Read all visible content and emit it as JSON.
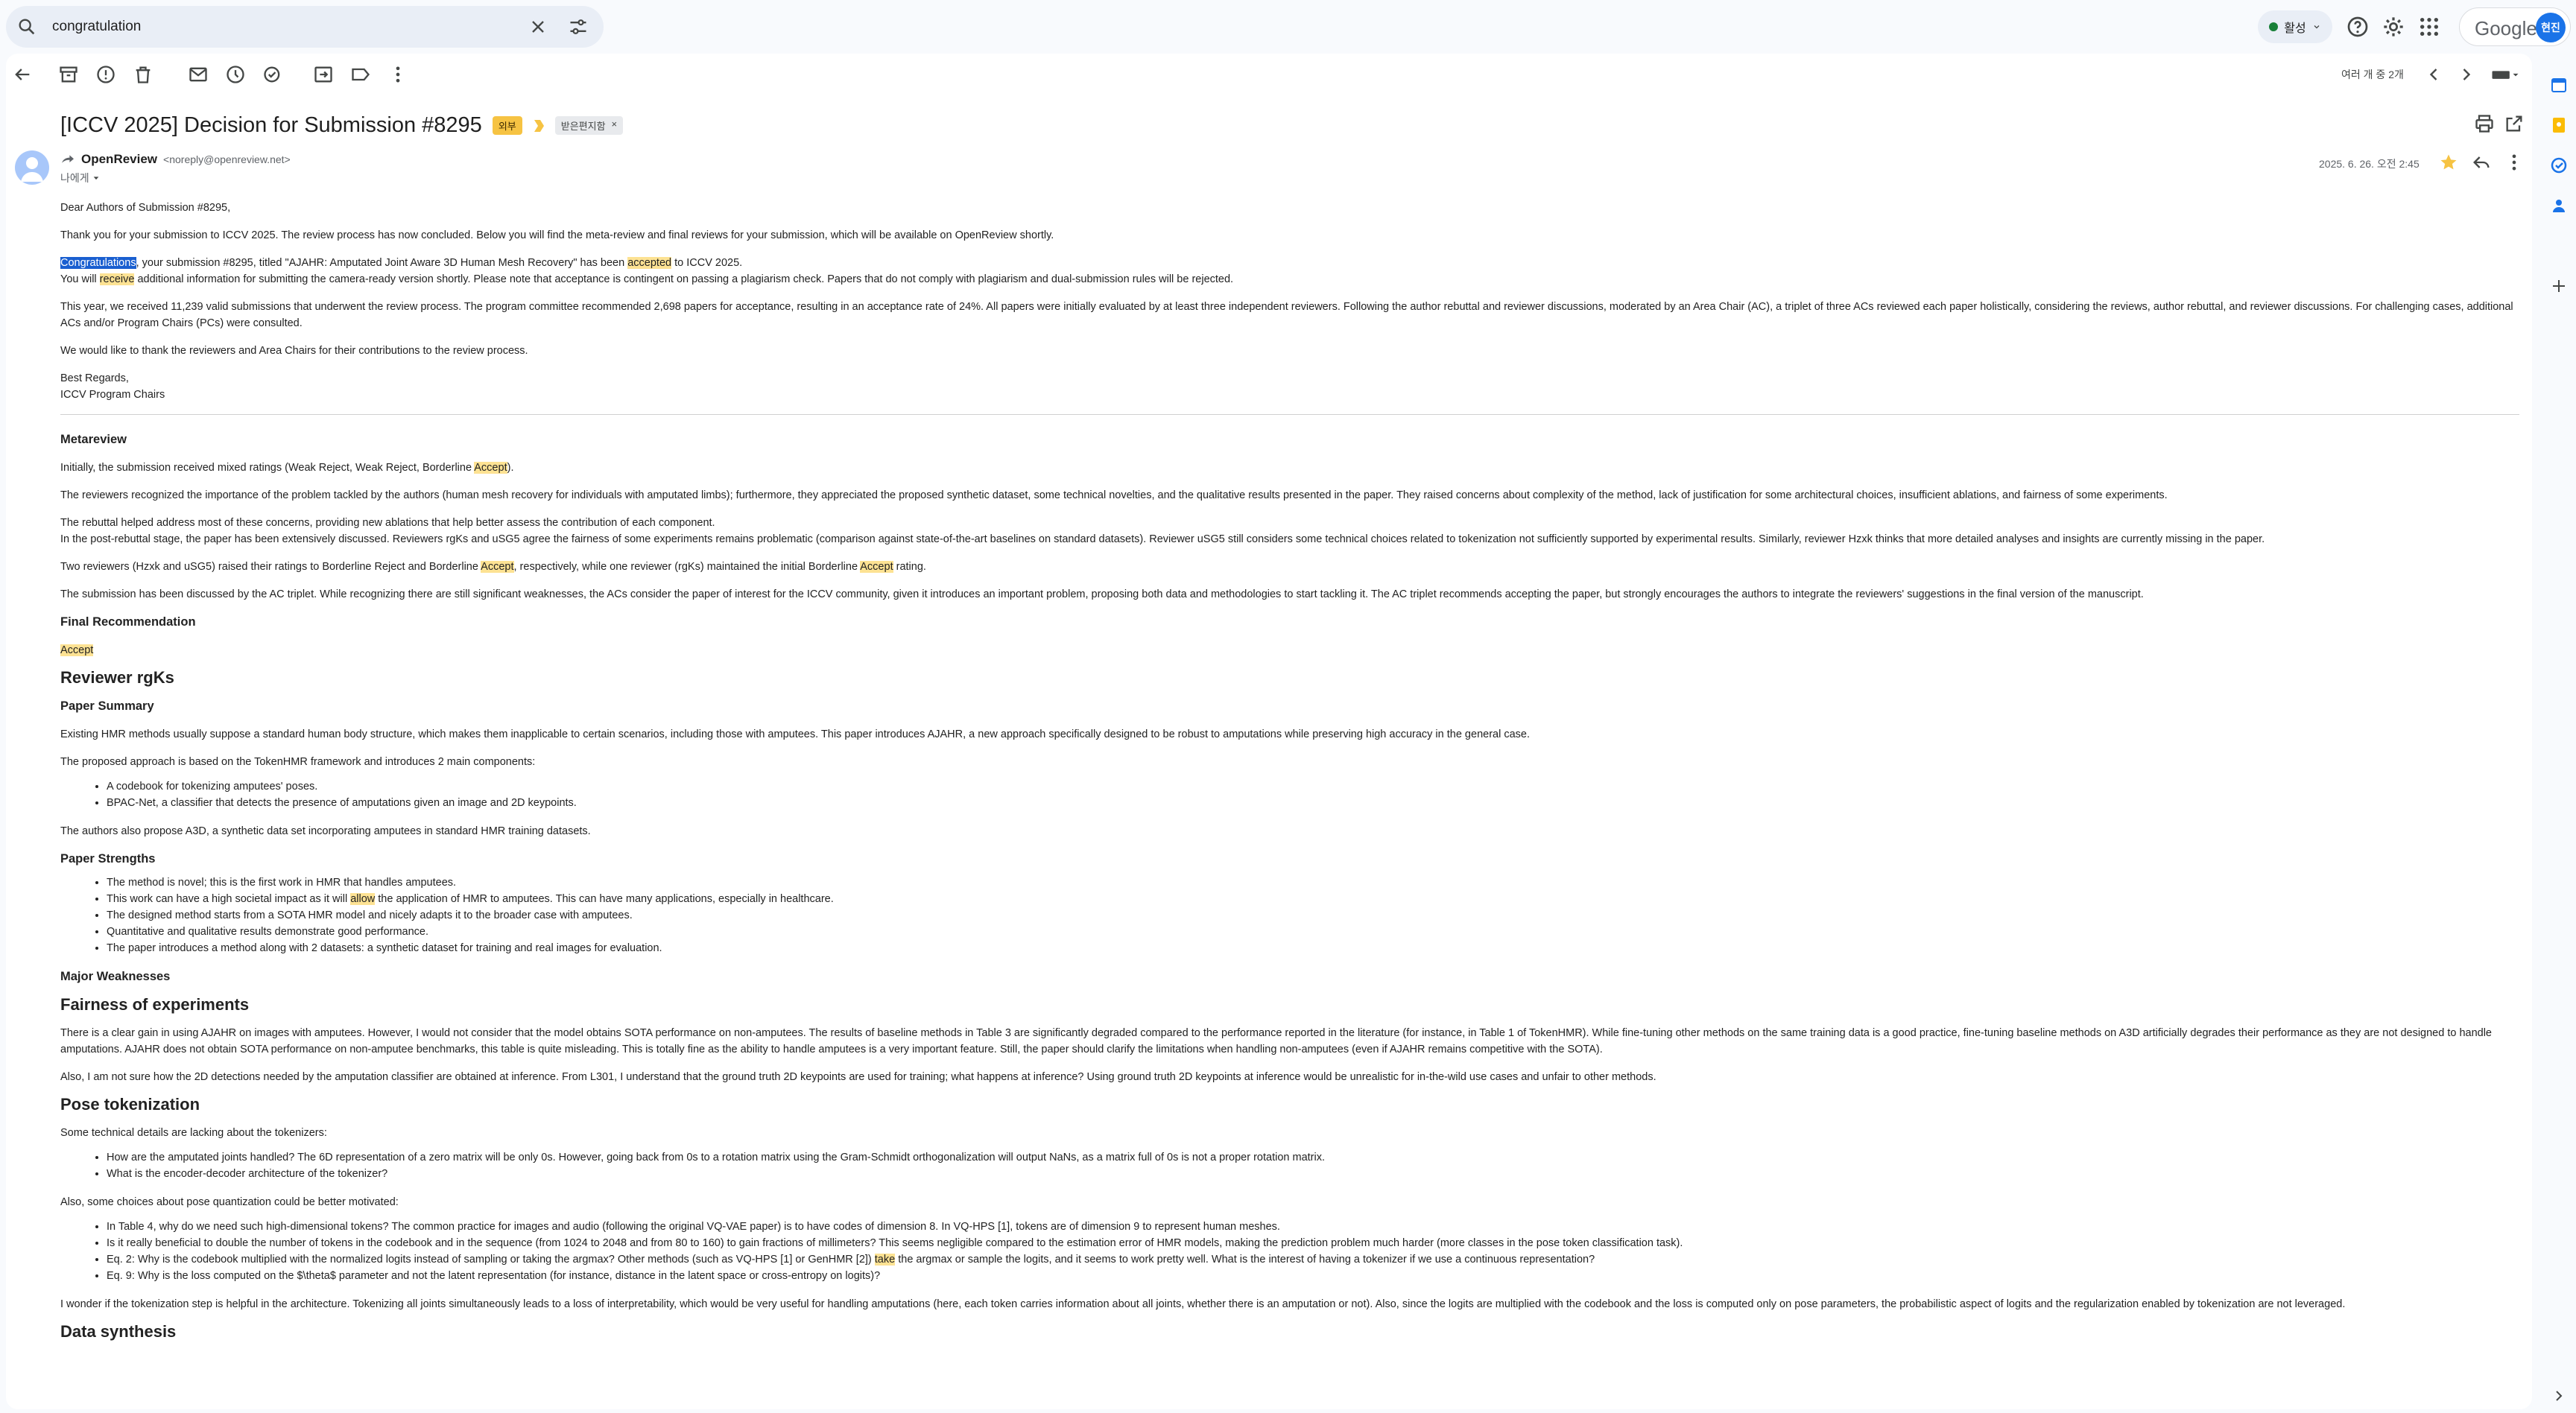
{
  "search": {
    "query": "congratulation"
  },
  "status": {
    "label": "활성"
  },
  "google": {
    "label": "Google",
    "avatar": "현진"
  },
  "toolbar": {
    "pager": "여러 개 중 2개"
  },
  "email": {
    "subject": "[ICCV 2025] Decision for Submission #8295",
    "label_external": "외부",
    "label_inbox": "받은편지함",
    "label_inbox_close": "×",
    "sender_name": "OpenReview",
    "sender_email": "<noreply@openreview.net>",
    "to_me": "나에게",
    "date": "2025. 6. 26. 오전 2:45"
  },
  "body": {
    "p1": "Dear Authors of Submission #8295,",
    "p2": "Thank you for your submission to ICCV 2025. The review process has now concluded. Below you will find the meta-review and final reviews for your submission, which will be available on OpenReview shortly.",
    "p3_sel": "Congratulations",
    "p3_a": ", your submission #8295, titled \"AJAHR: Amputated Joint Aware 3D Human Mesh Recovery\" has been ",
    "p3_hl": "accepted",
    "p3_b": " to ICCV 2025.",
    "p4_a": "You will ",
    "p4_hl": "receive",
    "p4_b": " additional information for submitting the camera-ready version shortly. Please note that acceptance is contingent on passing a plagiarism check. Papers that do not comply with plagiarism and dual-submission rules will be rejected.",
    "p5": "This year, we received 11,239 valid submissions that underwent the review process. The program committee recommended 2,698 papers for acceptance, resulting in an acceptance rate of 24%. All papers were initially evaluated by at least three independent reviewers. Following the author rebuttal and reviewer discussions, moderated by an Area Chair (AC), a triplet of three ACs reviewed each paper holistically, considering the reviews, author rebuttal, and reviewer discussions. For challenging cases, additional ACs and/or Program Chairs (PCs) were consulted.",
    "p6": "We would like to thank the reviewers and Area Chairs for their contributions to the review process.",
    "p7a": "Best Regards,",
    "p7b": "ICCV Program Chairs",
    "meta_title": "Metareview",
    "m1_a": "Initially, the submission received mixed ratings (Weak Reject, Weak Reject, Borderline ",
    "m1_hl": "Accept",
    "m1_b": ").",
    "m2": "The reviewers recognized the importance of the problem tackled by the authors (human mesh recovery for individuals with amputated limbs); furthermore, they appreciated the proposed synthetic dataset, some technical novelties, and the qualitative results presented in the paper. They raised concerns about complexity of the method, lack of justification for some architectural choices, insufficient ablations, and fairness of some experiments.",
    "m3a": "The rebuttal helped address most of these concerns, providing new ablations that help better assess the contribution of each component.",
    "m3b": "In the post-rebuttal stage, the paper has been extensively discussed. Reviewers rgKs and uSG5 agree the fairness of some experiments remains problematic (comparison against state-of-the-art baselines on standard datasets). Reviewer uSG5 still considers some technical choices related to tokenization not sufficiently supported by experimental results. Similarly, reviewer Hzxk thinks that more detailed analyses and insights are currently missing in the paper.",
    "m4_a": "Two reviewers (Hzxk and uSG5) raised their ratings to Borderline Reject and Borderline ",
    "m4_hl1": "Accept",
    "m4_b": ", respectively, while one reviewer (rgKs) maintained the initial Borderline ",
    "m4_hl2": "Accept",
    "m4_c": " rating.",
    "m5": "The submission has been discussed by the AC triplet. While recognizing there are still significant weaknesses, the ACs consider the paper of interest for the ICCV community, given it introduces an important problem, proposing both data and methodologies to start tackling it. The AC triplet recommends accepting the paper, but strongly encourages the authors to integrate the reviewers' suggestions in the final version of the manuscript.",
    "final_title": "Final Recommendation",
    "final_value": "Accept",
    "rev_title": "Reviewer rgKs",
    "ps_title": "Paper Summary",
    "ps1": "Existing HMR methods usually suppose a standard human body structure, which makes them inapplicable to certain scenarios, including those with amputees. This paper introduces AJAHR, a new approach specifically designed to be robust to amputations while preserving high accuracy in the general case.",
    "ps2": "The proposed approach is based on the TokenHMR framework and introduces 2 main components:",
    "ps_items": [
      "A codebook for tokenizing amputees' poses.",
      "BPAC-Net, a classifier that detects the presence of amputations given an image and 2D keypoints."
    ],
    "ps3": "The authors also propose A3D, a synthetic data set incorporating amputees in standard HMR training datasets.",
    "str_title": "Paper Strengths",
    "str1": "The method is novel; this is the first work in HMR that handles amputees.",
    "str2_a": "This work can have a high societal impact as it will ",
    "str2_hl": "allow",
    "str2_b": " the application of HMR to amputees. This can have many applications, especially in healthcare.",
    "str3": "The designed method starts from a SOTA HMR model and nicely adapts it to the broader case with amputees.",
    "str4": "Quantitative and qualitative results demonstrate good performance.",
    "str5": "The paper introduces a method along with 2 datasets: a synthetic dataset for training and real images for evaluation.",
    "weak_title": "Major Weaknesses",
    "fair_title": "Fairness of experiments",
    "f1": "There is a clear gain in using AJAHR on images with amputees. However, I would not consider that the model obtains SOTA performance on non-amputees. The results of baseline methods in Table 3 are significantly degraded compared to the performance reported in the literature (for instance, in Table 1 of TokenHMR). While fine-tuning other methods on the same training data is a good practice, fine-tuning baseline methods on A3D artificially degrades their performance as they are not designed to handle amputations. AJAHR does not obtain SOTA performance on non-amputee benchmarks, this table is quite misleading. This is totally fine as the ability to handle amputees is a very important feature. Still, the paper should clarify the limitations when handling non-amputees (even if AJAHR remains competitive with the SOTA).",
    "f2": "Also, I am not sure how the 2D detections needed by the amputation classifier are obtained at inference. From L301, I understand that the ground truth 2D keypoints are used for training; what happens at inference? Using ground truth 2D keypoints at inference would be unrealistic for in-the-wild use cases and unfair to other methods.",
    "pose_title": "Pose tokenization",
    "pt1": "Some technical details are lacking about the tokenizers:",
    "pt_items": [
      "How are the amputated joints handled? The 6D representation of a zero matrix will be only 0s. However, going back from 0s to a rotation matrix using the Gram-Schmidt orthogonalization will output NaNs, as a matrix full of 0s is not a proper rotation matrix.",
      "What is the encoder-decoder architecture of the tokenizer?"
    ],
    "pt2": "Also, some choices about pose quantization could be better motivated:",
    "pq1": "In Table 4, why do we need such high-dimensional tokens? The common practice for images and audio (following the original VQ-VAE paper) is to have codes of dimension 8. In VQ-HPS [1], tokens are of dimension 9 to represent human meshes.",
    "pq2": "Is it really beneficial to double the number of tokens in the codebook and in the sequence (from 1024 to 2048 and from 80 to 160) to gain fractions of millimeters? This seems negligible compared to the estimation error of HMR models, making the prediction problem much harder (more classes in the pose token classification task).",
    "pq3_a": "Eq. 2: Why is the codebook multiplied with the normalized logits instead of sampling or taking the argmax? Other methods (such as VQ-HPS [1] or GenHMR [2]) ",
    "pq3_hl": "take",
    "pq3_b": " the argmax or sample the logits, and it seems to work pretty well. What is the interest of having a tokenizer if we use a continuous representation?",
    "pq4": "Eq. 9: Why is the loss computed on the $\\theta$ parameter and not the latent representation (for instance, distance in the latent space or cross-entropy on logits)?",
    "pt3": "I wonder if the tokenization step is helpful in the architecture. Tokenizing all joints simultaneously leads to a loss of interpretability, which would be very useful for handling amputations (here, each token carries information about all joints, whether there is an amputation or not). Also, since the logits are multiplied with the codebook and the loss is computed only on pose parameters, the probabilistic aspect of logits and the regularization enabled by tokenization are not leveraged.",
    "ds_title": "Data synthesis"
  }
}
